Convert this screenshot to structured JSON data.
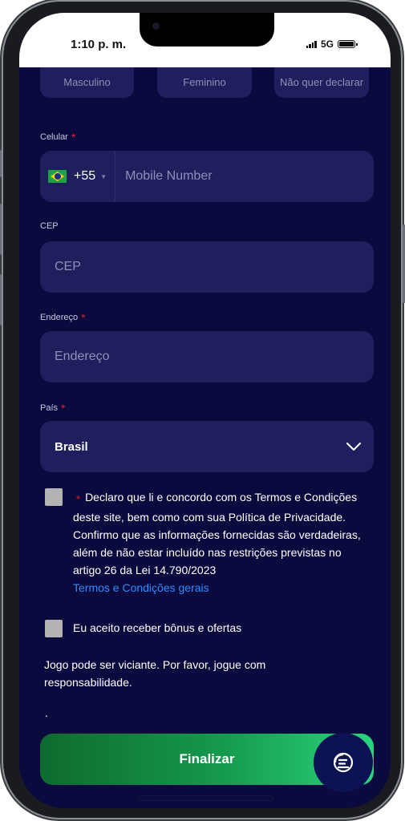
{
  "status_bar": {
    "time": "1:10 p. m.",
    "network": "5G"
  },
  "gender": {
    "options": [
      "Masculino",
      "Feminino",
      "Não quer declarar"
    ]
  },
  "phone": {
    "label": "Celular",
    "dial_code": "+55",
    "placeholder": "Mobile Number"
  },
  "cep": {
    "label": "CEP",
    "placeholder": "CEP"
  },
  "address": {
    "label": "Endereço",
    "placeholder": "Endereço"
  },
  "country": {
    "label": "País",
    "value": "Brasil"
  },
  "terms": {
    "text": "Declaro que li e concordo com os Termos e Condições deste site, bem como com sua Política de Privacidade. Confirmo que as informações fornecidas são verdadeiras, além de não estar incluído nas restrições previstas no artigo 26 da Lei 14.790/2023",
    "link": "Termos e Condições gerais"
  },
  "bonus": {
    "text": "Eu aceito receber bônus e ofertas"
  },
  "warning": "Jogo pode ser viciante. Por favor, jogue com responsabilidade.",
  "footer_dot": ".",
  "submit_label": "Finalizar",
  "required_mark": "*",
  "colors": {
    "background": "#0b0a3e",
    "field": "#1e1f5c",
    "required": "#e0202a",
    "link": "#2e8cff",
    "button_start": "#0f6a2e",
    "button_end": "#2bd47e"
  },
  "icons": {
    "country_flag": "brazil-flag-icon",
    "select": "chevron-down-icon",
    "fab": "chat-support-icon"
  }
}
